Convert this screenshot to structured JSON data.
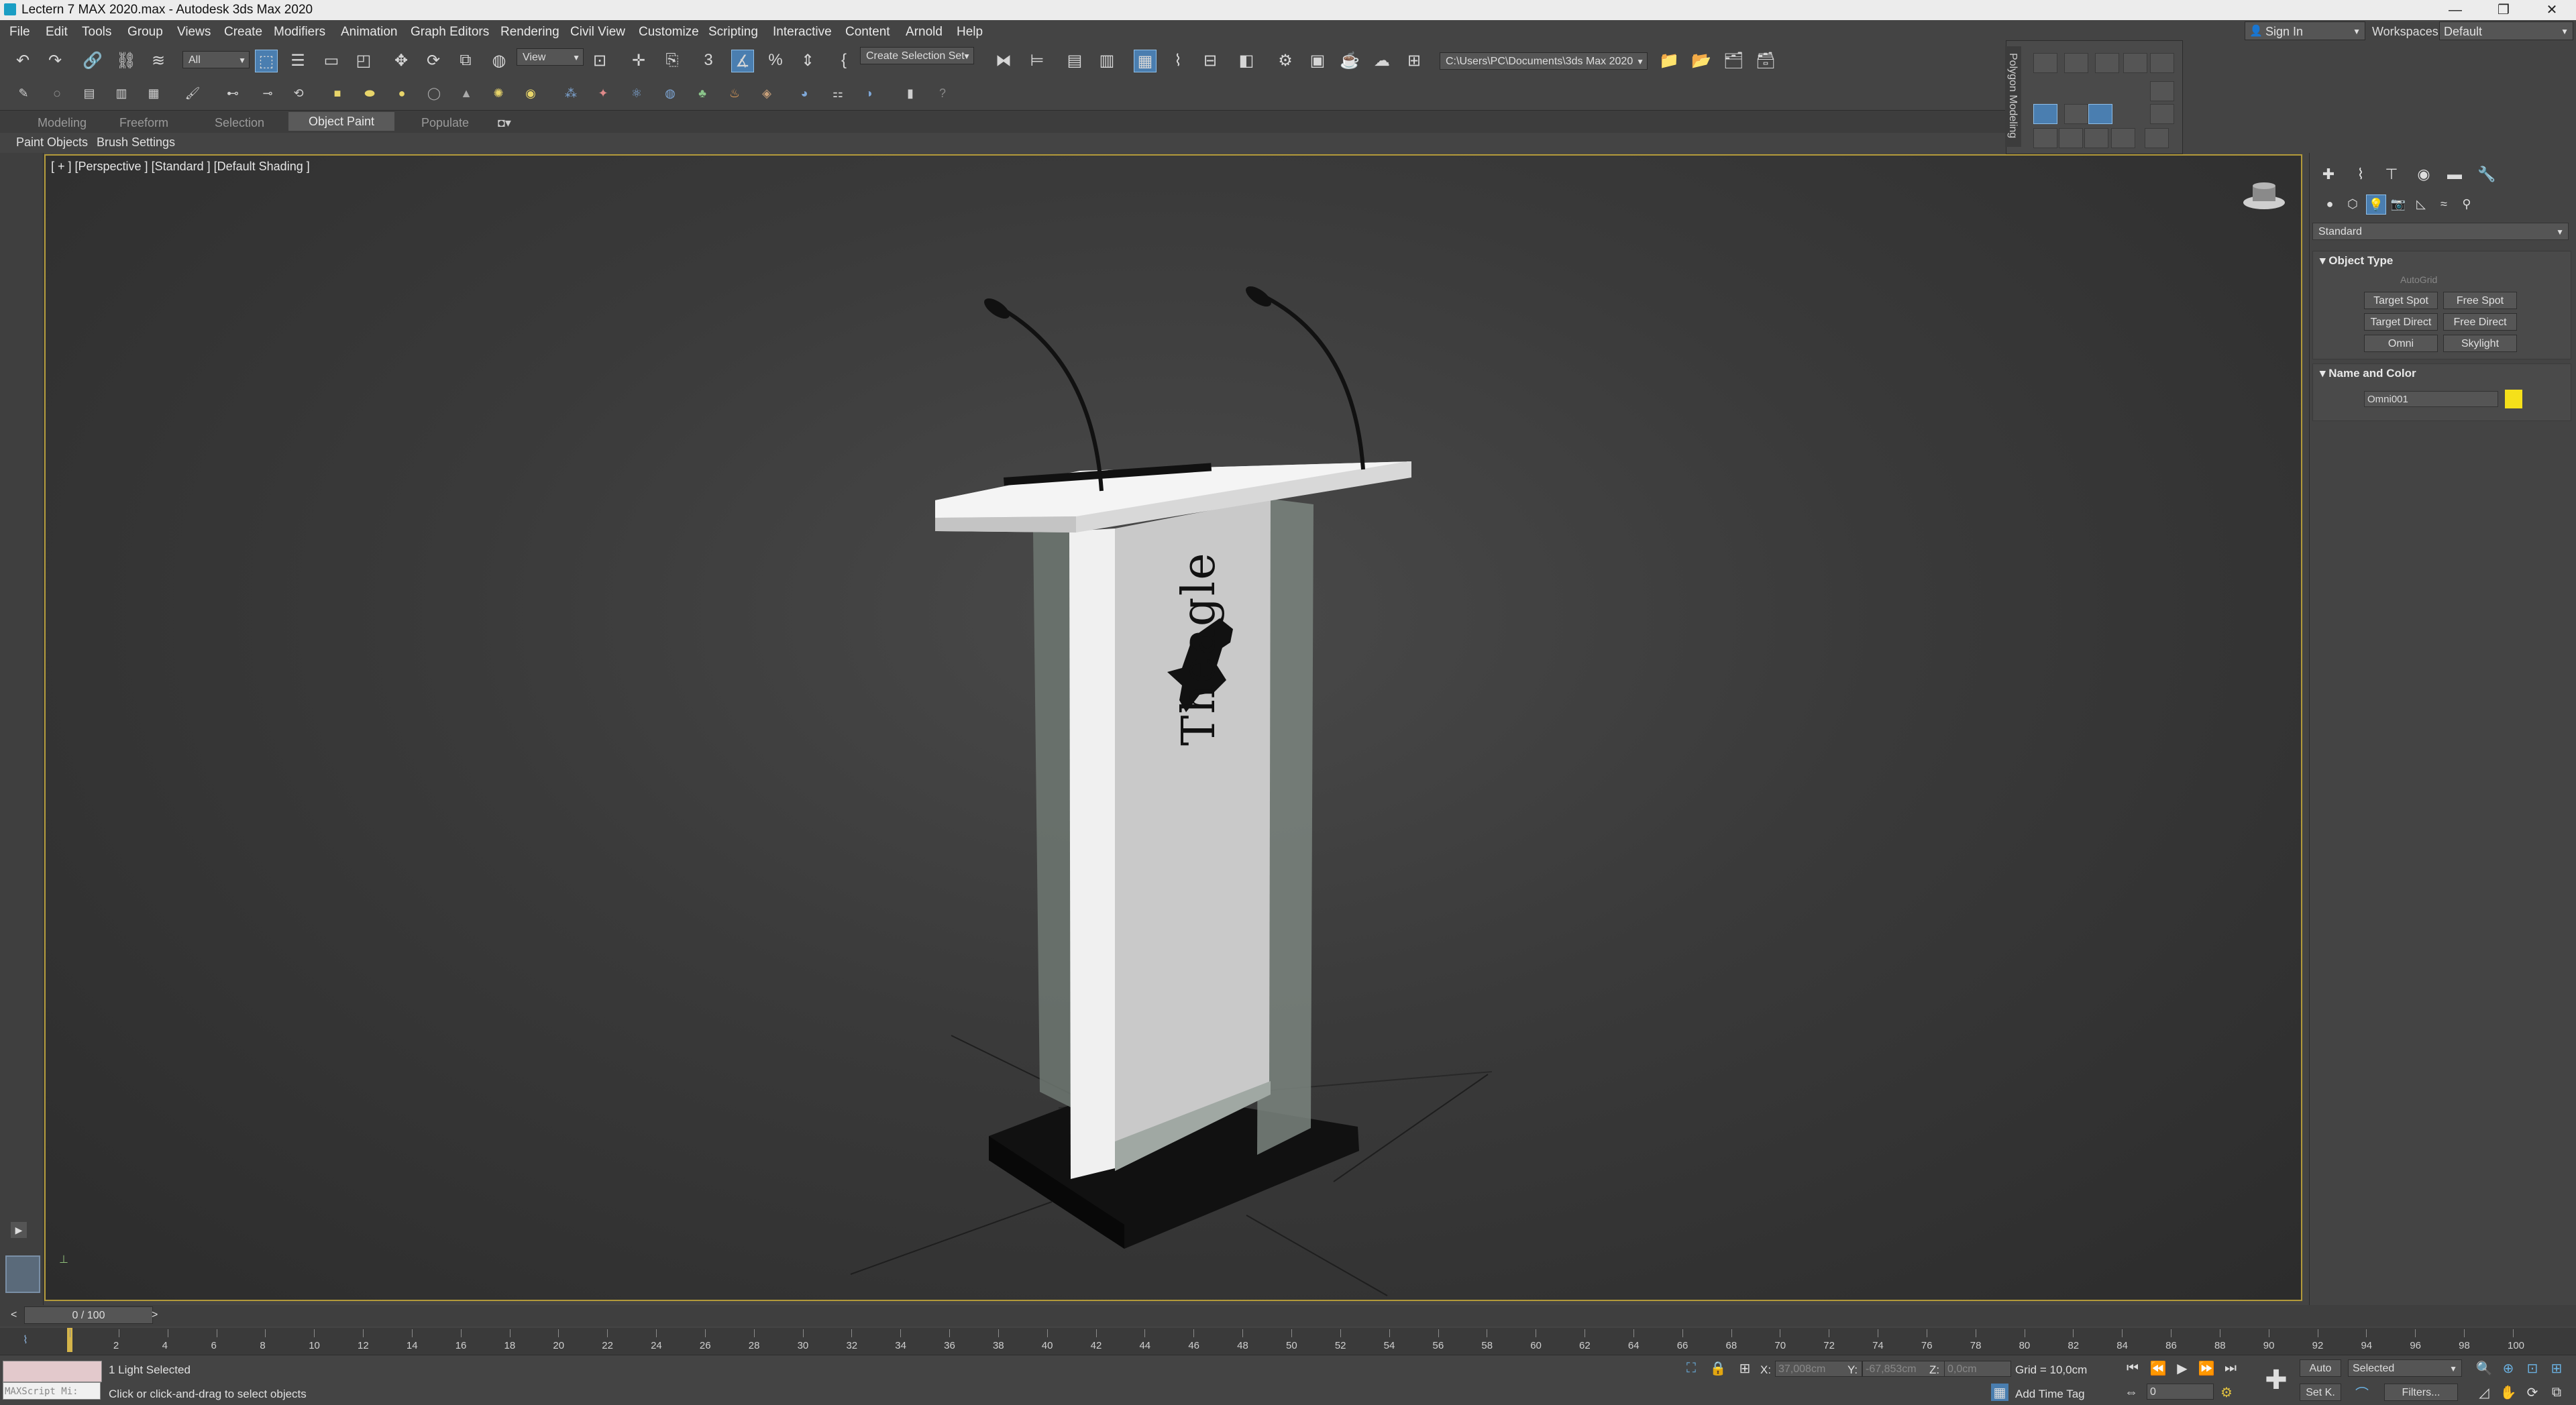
{
  "window": {
    "title": "Lectern 7 MAX 2020.max - Autodesk 3ds Max 2020",
    "minimize": "—",
    "restore": "❐",
    "close": "✕"
  },
  "menu": [
    "File",
    "Edit",
    "Tools",
    "Group",
    "Views",
    "Create",
    "Modifiers",
    "Animation",
    "Graph Editors",
    "Rendering",
    "Civil View",
    "Customize",
    "Scripting",
    "Interactive",
    "Content",
    "Arnold",
    "Help"
  ],
  "account": {
    "sign_in": "Sign In",
    "workspaces_label": "Workspaces:",
    "workspace_value": "Default"
  },
  "toolbar": {
    "selection_filter": "All",
    "ref_coord": "View",
    "named_selection": "Create Selection Set",
    "project_path": "C:\\Users\\PC\\Documents\\3ds Max 2020"
  },
  "ribbon": {
    "tabs": [
      "Modeling",
      "Freeform",
      "Selection",
      "Object Paint",
      "Populate"
    ],
    "active_tab": "Object Paint",
    "subtabs": [
      "Paint Objects",
      "Brush Settings"
    ]
  },
  "polygon_panel": {
    "label": "Polygon Modeling"
  },
  "viewport": {
    "label": "[ + ] [Perspective ] [Standard ] [Default Shading ]",
    "logo_text": "Theagle"
  },
  "command_panel": {
    "category": "Standard",
    "object_type": {
      "title": "Object Type",
      "autogrid": "AutoGrid",
      "buttons": [
        "Target Spot",
        "Free Spot",
        "Target Direct",
        "Free Direct",
        "Omni",
        "Skylight"
      ]
    },
    "name_color": {
      "title": "Name and Color",
      "name": "Omni001",
      "color": "#f5e01a"
    }
  },
  "timeline": {
    "frame_counter": "0 / 100",
    "ticks": [
      "0",
      "2",
      "4",
      "6",
      "8",
      "10",
      "12",
      "14",
      "16",
      "18",
      "20",
      "22",
      "24",
      "26",
      "28",
      "30",
      "32",
      "34",
      "36",
      "38",
      "40",
      "42",
      "44",
      "46",
      "48",
      "50",
      "52",
      "54",
      "56",
      "58",
      "60",
      "62",
      "64",
      "66",
      "68",
      "70",
      "72",
      "74",
      "76",
      "78",
      "80",
      "82",
      "84",
      "86",
      "88",
      "90",
      "92",
      "94",
      "96",
      "98",
      "100"
    ]
  },
  "status": {
    "maxscript": "MAXScript Mi:",
    "selection": "1 Light Selected",
    "prompt": "Click or click-and-drag to select objects",
    "x_label": "X:",
    "x_value": "37,008cm",
    "y_label": "Y:",
    "y_value": "-67,853cm",
    "z_label": "Z:",
    "z_value": "0,0cm",
    "grid": "Grid = 10,0cm",
    "add_time_tag": "Add Time Tag",
    "auto": "Auto",
    "set_key": "Set K.",
    "selected": "Selected",
    "filters": "Filters...",
    "frame": "0"
  }
}
